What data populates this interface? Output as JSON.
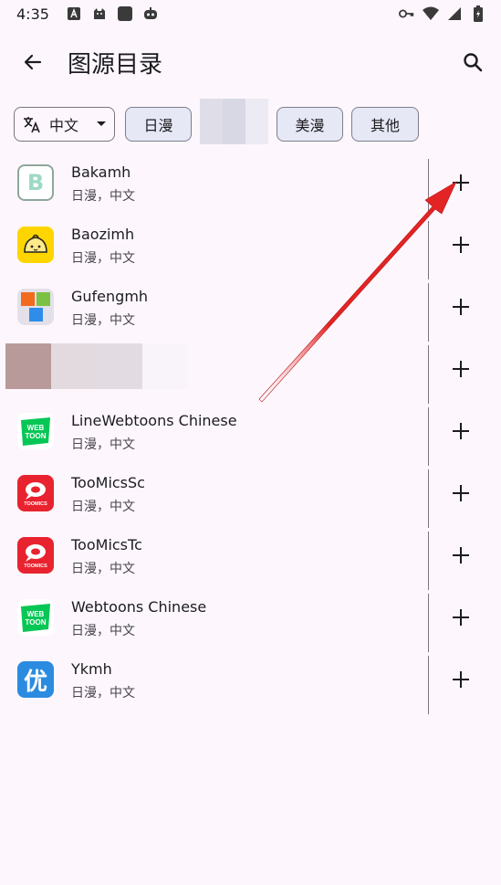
{
  "status_bar": {
    "time": "4:35",
    "left_icons": [
      "font-icon",
      "android-icon",
      "square-app-icon",
      "robot-icon"
    ],
    "right_icons": [
      "key-icon",
      "wifi-icon",
      "signal-icon",
      "battery-icon"
    ]
  },
  "app_bar": {
    "title": "图源目录",
    "back_icon": "arrow-back-icon",
    "search_icon": "search-icon"
  },
  "filters": {
    "language_chip": {
      "label": "中文",
      "icon": "translate-icon"
    },
    "chips": [
      {
        "label": "日漫",
        "selected": true
      },
      {
        "label": "美漫",
        "selected": true
      },
      {
        "label": "其他",
        "selected": true
      }
    ]
  },
  "sources": [
    {
      "name": "Bakamh",
      "tags": "日漫，中文"
    },
    {
      "name": "Baozimh",
      "tags": "日漫，中文"
    },
    {
      "name": "Gufengmh",
      "tags": "日漫，中文"
    },
    {
      "name": "",
      "tags": ""
    },
    {
      "name": "LineWebtoons Chinese",
      "tags": "日漫，中文"
    },
    {
      "name": "TooMicsSc",
      "tags": "日漫，中文"
    },
    {
      "name": "TooMicsTc",
      "tags": "日漫，中文"
    },
    {
      "name": "Webtoons Chinese",
      "tags": "日漫，中文"
    },
    {
      "name": "Ykmh",
      "tags": "日漫，中文"
    }
  ],
  "icon_text": {
    "bakamh": "B",
    "webtoon_top": "WEB",
    "webtoon_bottom": "TOON",
    "toomics": "TOOMICS",
    "ykmh": "优"
  },
  "colors": {
    "background": "#fdf7fd",
    "chip_selected": "#e6e8f6",
    "arrow": "#e32424",
    "webtoon_green": "#06c755",
    "toomics_red": "#e8232f",
    "ykmh_blue": "#2b8be0"
  }
}
